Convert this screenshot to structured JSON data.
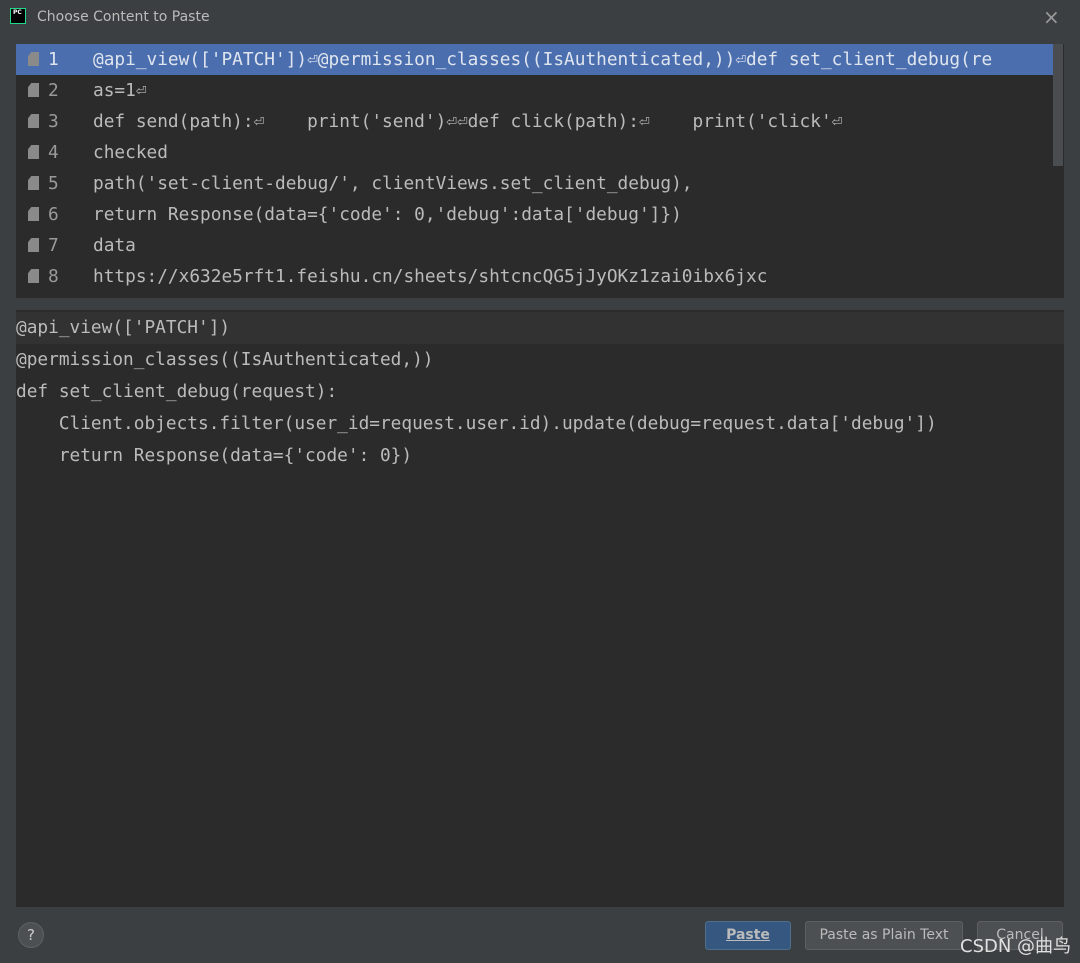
{
  "window": {
    "title": "Choose Content to Paste",
    "app_icon": "pycharm-icon",
    "close": "×"
  },
  "list": {
    "items": [
      {
        "n": "1",
        "text": "@api_view(['PATCH'])⏎@permission_classes((IsAuthenticated,))⏎def set_client_debug(re"
      },
      {
        "n": "2",
        "text": "as=1⏎"
      },
      {
        "n": "3",
        "text": "def send(path):⏎    print('send')⏎⏎def click(path):⏎    print('click'⏎"
      },
      {
        "n": "4",
        "text": "checked"
      },
      {
        "n": "5",
        "text": "path('set-client-debug/', clientViews.set_client_debug),"
      },
      {
        "n": "6",
        "text": "return Response(data={'code': 0,'debug':data['debug']})"
      },
      {
        "n": "7",
        "text": "data"
      },
      {
        "n": "8",
        "text": "https://x632e5rft1.feishu.cn/sheets/shtcncQG5jJyOKz1zai0ibx6jxc"
      }
    ],
    "selected": 0
  },
  "preview": {
    "lines": [
      "@api_view(['PATCH'])",
      "@permission_classes((IsAuthenticated,))",
      "def set_client_debug(request):",
      "    Client.objects.filter(user_id=request.user.id).update(debug=request.data['debug'])",
      "    return Response(data={'code': 0})"
    ]
  },
  "footer": {
    "help": "?",
    "paste": "Paste",
    "paste_plain": "Paste as Plain Text",
    "cancel": "Cancel"
  },
  "watermark": "CSDN @曲鸟",
  "colors": {
    "selection": "#4b6eaf",
    "default_button": "#365880"
  }
}
